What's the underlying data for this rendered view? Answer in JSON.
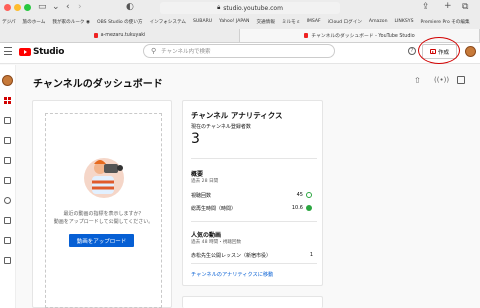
{
  "browser": {
    "url": "studio.youtube.com",
    "bookmarks": [
      "デジパ",
      "旅のホーム",
      "我が家のルーク ◉",
      "OBS Studio の使い方",
      "インフォシステム",
      "SUBARU",
      "Yahoo! JAPAN",
      "交通情報",
      "ミルモ ε",
      "IMSAF",
      "iCloud ログイン",
      "Amazon",
      "LINKSYS",
      "Premiere Pro その編集"
    ],
    "tabs": [
      {
        "label": "a-mezaru.tukuyaki",
        "active": false
      },
      {
        "label": "チャンネルのダッシュボード - YouTube Studio",
        "active": true
      }
    ]
  },
  "header": {
    "brand": "Studio",
    "search_placeholder": "チャンネル内で検索",
    "help_label": "?",
    "create_label": "作成"
  },
  "page": {
    "title": "チャンネルのダッシュボード"
  },
  "upload_card": {
    "message_line1": "最近の動画の指標を表示しますか？",
    "message_line2": "動画をアップロードして公開してください。",
    "button_label": "動画をアップロード"
  },
  "analytics": {
    "title": "チャンネル アナリティクス",
    "subscribers_label": "現在のチャンネル登録者数",
    "subscribers_count": "3",
    "summary_title": "概要",
    "summary_period": "過去 28 日間",
    "metrics": [
      {
        "label": "視聴回数",
        "value": "45"
      },
      {
        "label": "総再生時間（時間）",
        "value": "10.6"
      }
    ],
    "popular_title": "人気の動画",
    "popular_period": "過去 48 時間・視聴回数",
    "popular_video_title": "赤松先生公開レッスン（新宿市役）",
    "popular_video_views": "1",
    "link_label": "チャンネルのアナリティクスに移動"
  },
  "colors": {
    "accent_red": "#ff0000",
    "link_blue": "#065fd4",
    "positive_green": "#2ba640"
  }
}
